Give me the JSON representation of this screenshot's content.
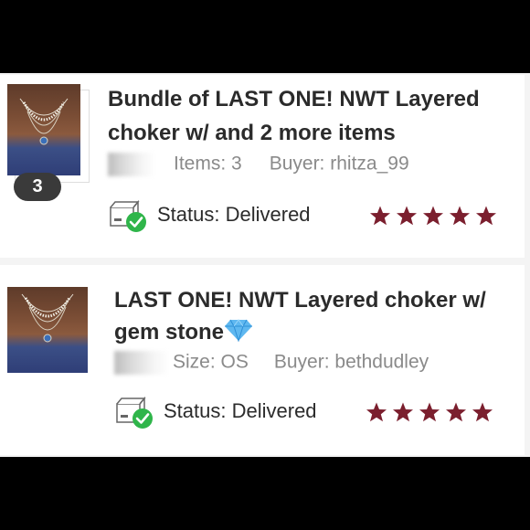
{
  "orders": [
    {
      "title_line1": "Bundle of LAST ONE! NWT Layered",
      "title_line2": "choker w/ and 2 more items",
      "count_badge": "3",
      "detail": "Items: 3",
      "buyer": "Buyer: rhitza_99",
      "status_label": "Status:",
      "status_value": "Delivered",
      "rating": 5
    },
    {
      "title_line1": "LAST ONE! NWT Layered choker w/",
      "title_line2": "gem stone",
      "detail": "Size: OS",
      "buyer": "Buyer: bethdudley",
      "status_label": "Status:",
      "status_value": "Delivered",
      "rating": 5
    }
  ],
  "colors": {
    "star": "#7b1f2e",
    "check": "#2fb54a",
    "badge": "#3a3a3a"
  },
  "icons": {
    "status": "package-delivered-icon",
    "rating": "star-icon",
    "gem": "gem-emoji-icon"
  }
}
